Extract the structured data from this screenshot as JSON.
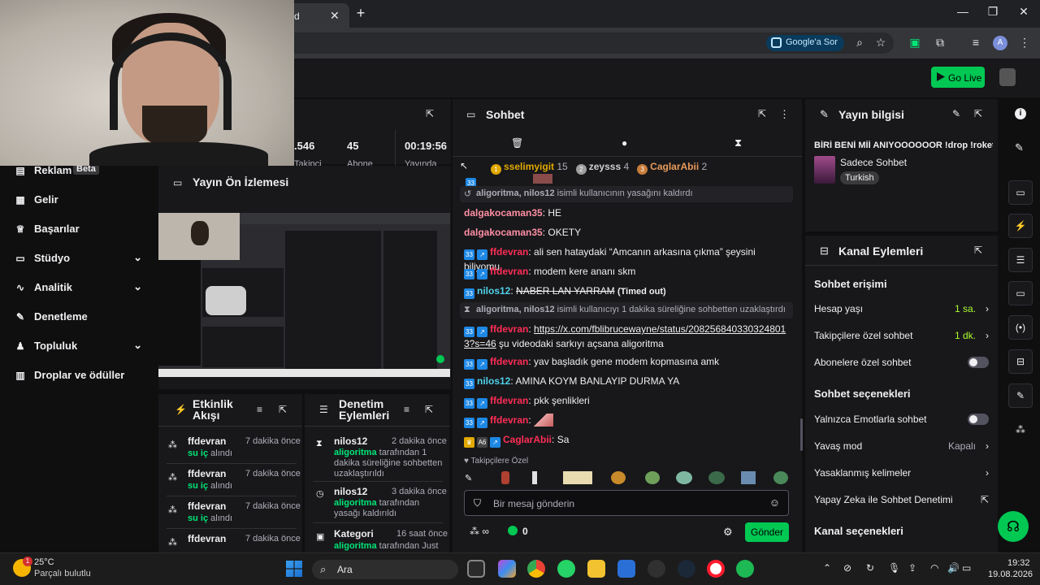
{
  "browser": {
    "tab_title": "d",
    "google_ask": "Google'a Sor",
    "avatar_letter": "A"
  },
  "header": {
    "go_live": "Go Live"
  },
  "nav": {
    "items": [
      {
        "label": "Reklam",
        "badge": "Beta"
      },
      {
        "label": "Gelir"
      },
      {
        "label": "Başarılar"
      },
      {
        "label": "Stüdyo"
      },
      {
        "label": "Analitik"
      },
      {
        "label": "Denetleme"
      },
      {
        "label": "Topluluk"
      },
      {
        "label": "Droplar ve ödüller"
      }
    ]
  },
  "stats": {
    "viewers": ".546",
    "followers": "45",
    "uptime": "00:19:56",
    "viewers_label": "Takipçi",
    "followers_label": "Abone",
    "uptime_label": "Yayında"
  },
  "preview": {
    "title": "Yayın Ön İzlemesi"
  },
  "activity": {
    "title": "Etkinlik Akışı",
    "items": [
      {
        "name": "ffdevran",
        "action_bold": "su iç",
        "action_rest": " alındı",
        "time": "7 dakika önce"
      },
      {
        "name": "ffdevran",
        "action_bold": "su iç",
        "action_rest": " alındı",
        "time": "7 dakika önce"
      },
      {
        "name": "ffdevran",
        "action_bold": "su iç",
        "action_rest": " alındı",
        "time": "7 dakika önce"
      },
      {
        "name": "ffdevran",
        "action_bold": "",
        "action_rest": "",
        "time": "7 dakika önce"
      }
    ]
  },
  "moderation": {
    "title": "Denetim Eylemleri",
    "items": [
      {
        "name": "nilos12",
        "time": "2 dakika önce",
        "by": "aligoritma",
        "text": " tarafından 1 dakika süreliğine sohbetten uzaklaştırıldı"
      },
      {
        "name": "nilos12",
        "time": "3 dakika önce",
        "by": "aligoritma",
        "text": " tarafından yasağı kaldırıldı"
      },
      {
        "name": "Kategori",
        "time": "16 saat önce",
        "by": "aligoritma",
        "text": " tarafından Just"
      }
    ]
  },
  "chat": {
    "title": "Sohbet",
    "leaderboard": [
      {
        "rank": "1",
        "name": "sselimyigit",
        "count": "15"
      },
      {
        "rank": "2",
        "name": "zeysss",
        "count": "4"
      },
      {
        "rank": "3",
        "name": "CaglarAbii",
        "count": "2"
      }
    ],
    "messages": [
      {
        "type": "system",
        "text_user": "aligoritma, nilos12",
        "text": " isimli kullanıcının yasağını kaldırdı"
      },
      {
        "type": "msg",
        "user": "dalgakocaman35",
        "color": "#ff8fa3",
        "text": "HE"
      },
      {
        "type": "msg",
        "user": "dalgakocaman35",
        "color": "#ff8fa3",
        "text": "OKETY"
      },
      {
        "type": "msg",
        "user": "ffdevran",
        "color": "#ff2d55",
        "text": "ali sen hataydaki “Amcanın arkasına çıkma” şeysini biliyomu"
      },
      {
        "type": "msg",
        "user": "ffdevran",
        "color": "#ff2d55",
        "text": "modem kere ananı skm"
      },
      {
        "type": "msg",
        "user": "nilos12",
        "color": "#4fd1e8",
        "text": "NABER LAN YARRAM",
        "note": "(Timed out)"
      },
      {
        "type": "system",
        "text_user": "aligoritma, nilos12",
        "text": " isimli kullanıcıyı 1 dakika süreliğine sohbetten uzaklaştırdı"
      },
      {
        "type": "msg",
        "user": "ffdevran",
        "color": "#ff2d55",
        "link": "https://x.com/fblibrucewayne/status/2082568403303248013?s=46",
        "text": "şu videodaki sarkıyı açsana aligoritma"
      },
      {
        "type": "msg",
        "user": "ffdevran",
        "color": "#ff2d55",
        "text": "yav başladık gene modem kopmasına amk"
      },
      {
        "type": "msg",
        "user": "nilos12",
        "color": "#4fd1e8",
        "text": "AMINA KOYM BANLAYIP DURMA YA"
      },
      {
        "type": "msg",
        "user": "ffdevran",
        "color": "#ff2d55",
        "text": "pkk şenlikleri"
      },
      {
        "type": "msg",
        "user": "ffdevran",
        "color": "#ff2d55",
        "text": ""
      },
      {
        "type": "msg",
        "user": "CaglarAbii",
        "color": "#ff2d55",
        "text": "Sa"
      }
    ],
    "followers_only_label": "Takipçilere Özel",
    "input_placeholder": "Bir mesaj gönderin",
    "points": "0",
    "send_label": "Gönder"
  },
  "stream_info": {
    "title": "Yayın bilgisi",
    "stream_title": "BİRİ BENİ Mİİ ANIYOOOOOOR !drop !roket",
    "category": "Sadece Sohbet",
    "language": "Turkish"
  },
  "channel_actions": {
    "title": "Kanal Eylemleri",
    "chat_access": "Sohbet erişimi",
    "account_age_label": "Hesap yaşı",
    "account_age_value": "1 sa.",
    "followers_only_label": "Takipçilere özel sohbet",
    "followers_only_value": "1 dk.",
    "subs_only_label": "Abonelere özel sohbet",
    "chat_options": "Sohbet seçenekleri",
    "emote_only_label": "Yalnızca Emotlarla sohbet",
    "slow_mode_label": "Yavaş mod",
    "slow_mode_value": "Kapalı",
    "banned_words_label": "Yasaklanmış kelimeler",
    "ai_mod_label": "Yapay Zeka ile Sohbet Denetimi",
    "channel_options": "Kanal seçenekleri"
  },
  "taskbar": {
    "weather_temp": "25°C",
    "weather_desc": "Parçalı bulutlu",
    "weather_badge": "1",
    "search_label": "Ara",
    "time": "19:32",
    "date": "19.08.2026"
  }
}
